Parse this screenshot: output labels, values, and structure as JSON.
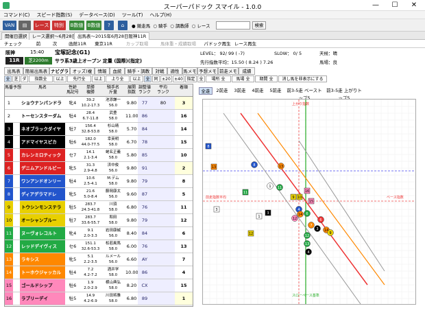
{
  "window": {
    "title": "スーパーパドック スマイル - 1.0.0",
    "minimize": "—",
    "maximize": "☐",
    "close": "✕"
  },
  "menu": [
    "コマンド(C)",
    "スピード指数(S)",
    "データベース(D)",
    "ツール(T)",
    "ヘルプ(H)"
  ],
  "toolbar": {
    "van": "VAN",
    "race": "レース",
    "special": "特別",
    "b1": "B数値",
    "b2": "B数値",
    "radio": [
      "競走馬",
      "騎手",
      "調教師",
      "レース"
    ],
    "search_label": "検索"
  },
  "tabs1": [
    "開催日選択",
    "レース選択～6月28日",
    "出馬表～2015年6月28日阪神11R"
  ],
  "tabs2": [
    "チェック",
    "前",
    "次",
    "函館11R",
    "東京11R",
    "カップ取場",
    "馬体重・成績取場",
    "パドック再生",
    "レース再生"
  ],
  "race": {
    "track": "阪神",
    "time": "15:40",
    "name": "宝塚記念(G1)",
    "level": "LEVEL： 92/ 99 ( -7)",
    "slow": "SLOW：  0/  5",
    "weather": "天候：晴",
    "racenum": "11R",
    "distance": "芝2200m",
    "condition": "サラ系3歳上オープン 定量 (国際)(指定)",
    "avg": "先行指数平均：15.50 ( 8.24 ) 7.26",
    "going": "馬場：良"
  },
  "subtabs": [
    "出馬表",
    "簡易出馬表",
    "ナビグラフ",
    "オッズ(複席)",
    "情報",
    "血統",
    "騎手・調教師",
    "対戦",
    "適性",
    "馬メモ",
    "予想メモ",
    "前走メモ",
    "成績"
  ],
  "filters": {
    "row": [
      "全",
      "芝",
      "ダ",
      "指数全",
      "以上",
      "先行全",
      "以上",
      "上り全",
      "以上",
      "全",
      "同",
      "±20",
      "±40",
      "指定",
      "全",
      "場所 全",
      "馬場 全",
      "期間 全",
      "消し馬を非表示にする"
    ]
  },
  "grid": {
    "headers": [
      "馬番",
      "予想",
      "馬名",
      "性齢\n馬記号",
      "単勝\n複勝",
      "騎手名\n斤量",
      "展開\n指数",
      "調整値\nランク",
      "平均\nランク",
      "着順"
    ],
    "rows": [
      {
        "num": "1",
        "name": "ショウナンパンドラ",
        "sex": "牝4",
        "odds": "39.2",
        "odds2": "10.2-17.3",
        "jockey": "池添謙一",
        "weight": "56.0",
        "tenkai": "9.80",
        "adj": "77",
        "avg": "80",
        "finish": "3"
      },
      {
        "num": "2",
        "name": "トーセンスターダム",
        "sex": "牡4",
        "odds": "28.4",
        "odds2": "6.7-11.8",
        "jockey": "武豊",
        "weight": "58.0",
        "tenkai": "11.00",
        "adj": "86",
        "avg": "",
        "finish": "16"
      },
      {
        "num": "3",
        "name": "ネオブラックダイヤ",
        "sex": "牡7",
        "odds": "156.4",
        "odds2": "32.8-53.8",
        "jockey": "杉山晴",
        "weight": "58.0",
        "tenkai": "5.70",
        "adj": "84",
        "avg": "",
        "finish": "14"
      },
      {
        "num": "4",
        "name": "アドマイヤスピカ",
        "sex": "牡6",
        "odds": "182.0",
        "odds2": "44.0-77.5",
        "jockey": "幸英明",
        "weight": "58.0",
        "tenkai": "6.70",
        "adj": "78",
        "avg": "",
        "finish": "15"
      },
      {
        "num": "5",
        "name": "カレンミロティック",
        "sex": "セ7",
        "odds": "14.1",
        "odds2": "2.1-3.4",
        "jockey": "蛯名正義",
        "weight": "58.0",
        "tenkai": "5.80",
        "adj": "85",
        "avg": "",
        "finish": "10"
      },
      {
        "num": "6",
        "name": "デニムアンドルビー",
        "sex": "牝5",
        "odds": "31.3",
        "odds2": "2.9-4.8",
        "jockey": "浜中俊",
        "weight": "56.0",
        "tenkai": "9.80",
        "adj": "91",
        "avg": "",
        "finish": "2"
      },
      {
        "num": "7",
        "name": "ワンアンドオンリー",
        "sex": "牡4",
        "odds": "10.6",
        "odds2": "2.5-4.1",
        "jockey": "M.デム",
        "weight": "58.0",
        "tenkai": "9.80",
        "adj": "79",
        "avg": "",
        "finish": "8"
      },
      {
        "num": "8",
        "name": "ディアデラマドレ",
        "sex": "牝5",
        "odds": "21.6",
        "odds2": "5.0-8.4",
        "jockey": "藤岡康太",
        "weight": "56.0",
        "tenkai": "9.60",
        "adj": "87",
        "avg": "",
        "finish": "5"
      },
      {
        "num": "9",
        "name": "トウシンモンステラ",
        "sex": "牡5",
        "odds": "283.7",
        "odds2": "24.3-41.8",
        "jockey": "川須",
        "weight": "58.0",
        "tenkai": "6.80",
        "adj": "76",
        "avg": "",
        "finish": "11"
      },
      {
        "num": "10",
        "name": "オーシャンブルー",
        "sex": "牡7",
        "odds": "283.7",
        "odds2": "33.6-55.7",
        "jockey": "和田",
        "weight": "58.0",
        "tenkai": "9.80",
        "adj": "79",
        "avg": "",
        "finish": "12"
      },
      {
        "num": "11",
        "name": "ヌーヴォレコルト",
        "sex": "牝4",
        "odds": "9.1",
        "odds2": "2.0-3.3",
        "jockey": "岩田康誠",
        "weight": "56.0",
        "tenkai": "8.40",
        "adj": "84",
        "avg": "",
        "finish": "6"
      },
      {
        "num": "12",
        "name": "レッドデイヴィス",
        "sex": "セ6",
        "odds": "151.1",
        "odds2": "32.6-53.3",
        "jockey": "松若風馬",
        "weight": "58.0",
        "tenkai": "6.00",
        "adj": "76",
        "avg": "",
        "finish": "13"
      },
      {
        "num": "13",
        "name": "ラキシス",
        "sex": "牝5",
        "odds": "5.1",
        "odds2": "2.2-3.5",
        "jockey": "ルメール",
        "weight": "56.0",
        "tenkai": "6.60",
        "adj": "AY",
        "avg": "",
        "finish": "7"
      },
      {
        "num": "14",
        "name": "トーホウジャッカル",
        "sex": "牡4",
        "odds": "7.2",
        "odds2": "4.2-7.2",
        "jockey": "酒井学",
        "weight": "58.0",
        "tenkai": "10.00",
        "adj": "86",
        "avg": "",
        "finish": "4"
      },
      {
        "num": "15",
        "name": "ゴールドシップ",
        "sex": "牡6",
        "odds": "1.9",
        "odds2": "2.0-2.9",
        "jockey": "横山典弘",
        "weight": "58.0",
        "tenkai": "8.20",
        "adj": "CX",
        "avg": "",
        "finish": "15"
      },
      {
        "num": "16",
        "name": "ラブリーデイ",
        "sex": "牡5",
        "odds": "14.9",
        "odds2": "4.2-6.9",
        "jockey": "川田将雅",
        "weight": "58.0",
        "tenkai": "6.80",
        "adj": "89",
        "avg": "",
        "finish": "1"
      }
    ]
  },
  "chart_tabs": [
    "全走",
    "2前走",
    "3前走",
    "4前走",
    "5前走",
    "前3-5走 ベーストップ5",
    "前3-5走 上がりトップ5"
  ],
  "chart_labels": {
    "top": "上がり指数",
    "bottom": "スローペース基準",
    "left": "前走指数平均",
    "right": "ベース指数"
  },
  "colors": {
    "frame1": "#ffffff",
    "frame2": "#000000",
    "frame3": "#dd2222",
    "frame4": "#2255cc",
    "frame5": "#e8d000",
    "frame6": "#22aa44",
    "frame7": "#ff8800",
    "frame8": "#ff88bb"
  }
}
